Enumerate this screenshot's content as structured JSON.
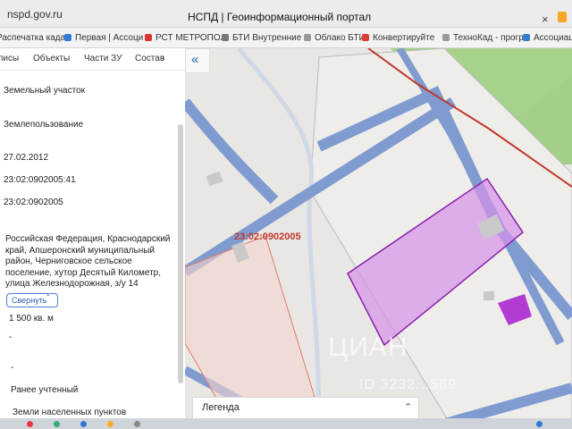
{
  "browser": {
    "url": "nspd.gov.ru",
    "title": "НСПД | Геоинформационный портал",
    "bookmarks": [
      "Распечатка када",
      "Первая | Ассоци",
      "РСТ МЕТРОПОЛ",
      "БТИ Внутренние",
      "Облако БТИ",
      "Конвертируйте",
      "ТехноКад - прогр",
      "Ассоциация"
    ]
  },
  "sidebar": {
    "tabs": [
      "писы",
      "Объекты",
      "Части ЗУ",
      "Состав"
    ],
    "type": "Земельный участок",
    "category_label": "Землепользование",
    "date": "27.02.2012",
    "cadastral_number": "23:02:0902005:41",
    "quarter": "23:02:0902005",
    "address": "Российская Федерация, Краснодарский край, Апшеронский муниципальный район, Черниговское сельское поселение, хутор Десятый Километр, улица Железнодорожная, з/у 14",
    "collapse_label": "Свернуть",
    "area": "1 500 кв. м",
    "dash1": "-",
    "dash2": "-",
    "status": "Ранее учтенный",
    "land_category": "Земли населенных пунктов"
  },
  "map": {
    "cadastral_label": "23:02:0902005",
    "legend_label": "Легенда",
    "watermark": "ЦИАН",
    "watermark_id": "ID 3232...589"
  },
  "colors": {
    "road": "#7f9bd0",
    "parcel": "#a13cc9",
    "green": "#8bc86a",
    "railway": "#c0392b"
  }
}
